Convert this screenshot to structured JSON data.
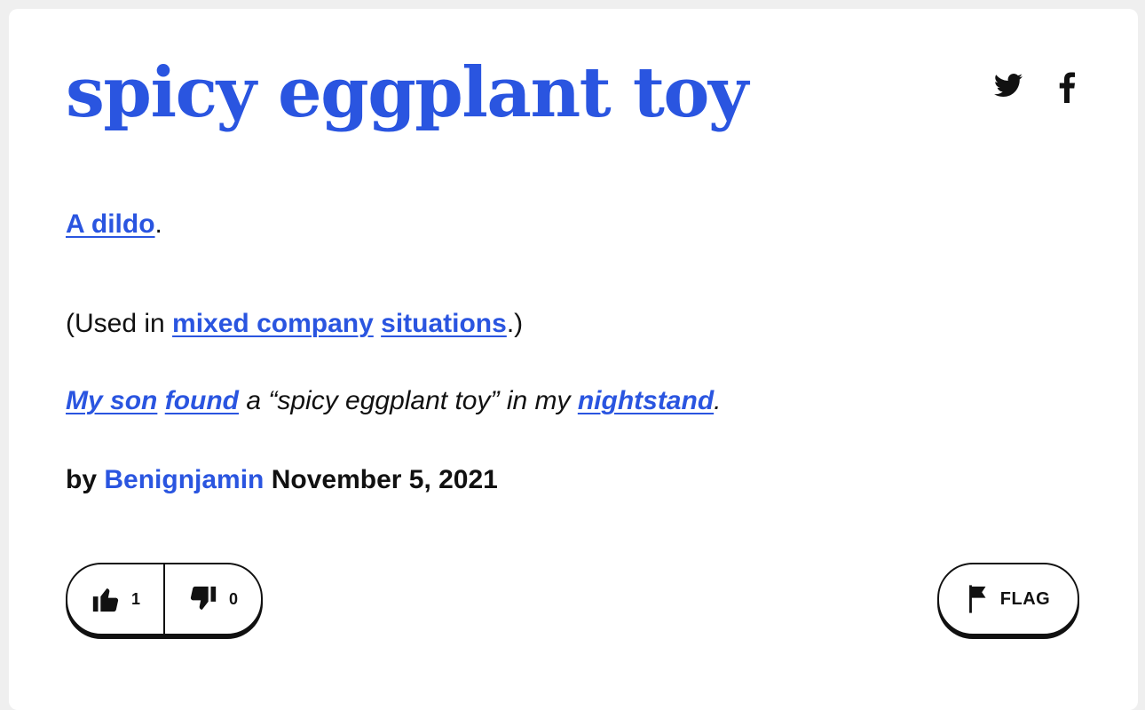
{
  "definition": {
    "word": "spicy eggplant toy",
    "meaning": {
      "link1": "A dildo",
      "after1": ".",
      "p2_before": "(Used in ",
      "link2": "mixed company",
      "space": " ",
      "link3": "situations",
      "p2_after": ".)"
    },
    "example": {
      "link1": "My son",
      "space": " ",
      "link2": "found",
      "middle": " a “spicy eggplant toy” in my ",
      "link3": "nightstand",
      "end": "."
    },
    "byline": {
      "prefix": "by ",
      "author": "Benignjamin",
      "date": " November 5, 2021"
    },
    "votes": {
      "up_count": "1",
      "down_count": "0"
    },
    "flag_label": "FLAG"
  },
  "share": {
    "twitter_icon": "twitter-icon",
    "facebook_icon": "facebook-icon"
  },
  "colors": {
    "accent": "#2a55e0",
    "text": "#111111",
    "background": "#efefef",
    "card": "#ffffff"
  }
}
